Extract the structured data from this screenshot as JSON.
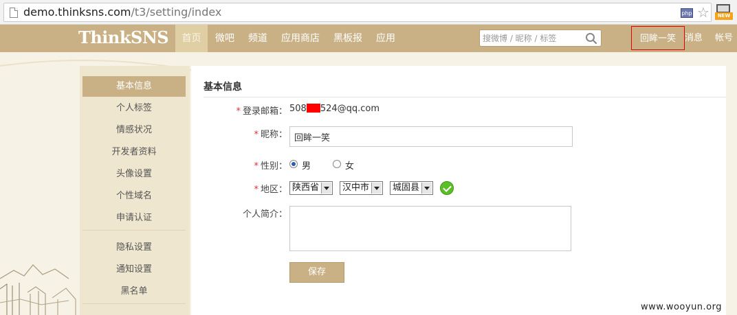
{
  "browser": {
    "url_host": "demo.thinksns.com",
    "url_path": "/t3/setting/index",
    "php_badge": "php",
    "new_badge": "NEW"
  },
  "nav": {
    "logo": "ThinkSNS",
    "items": [
      {
        "label": "首页",
        "active": true
      },
      {
        "label": "微吧",
        "active": false
      },
      {
        "label": "频道",
        "active": false
      },
      {
        "label": "应用商店",
        "active": false
      },
      {
        "label": "黑板报",
        "active": false
      },
      {
        "label": "应用",
        "active": false
      }
    ],
    "search_placeholder": "搜微博 / 昵称 / 标签",
    "user": "回眸一笑",
    "messages": "消息",
    "account": "帐号"
  },
  "sidebar": {
    "items": [
      {
        "label": "基本信息",
        "active": true
      },
      {
        "label": "个人标签",
        "active": false
      },
      {
        "label": "情感状况",
        "active": false
      },
      {
        "label": "开发者资料",
        "active": false
      },
      {
        "label": "头像设置",
        "active": false
      },
      {
        "label": "个性域名",
        "active": false
      },
      {
        "label": "申请认证",
        "active": false
      },
      {
        "label": "隐私设置",
        "active": false
      },
      {
        "label": "通知设置",
        "active": false
      },
      {
        "label": "黑名单",
        "active": false
      }
    ]
  },
  "form": {
    "title": "基本信息",
    "required_mark": "*",
    "email_label": "登录邮箱：",
    "email_prefix": "508",
    "email_suffix": "524@qq.com",
    "nickname_label": "昵称：",
    "nickname_value": "回眸一笑",
    "gender_label": "性别：",
    "gender_male": "男",
    "gender_female": "女",
    "gender_selected": "男",
    "region_label": "地区：",
    "province": "陕西省",
    "city": "汉中市",
    "county": "城固县",
    "bio_label": "个人简介：",
    "bio_value": "",
    "save_label": "保存"
  },
  "watermark": "www.wooyun.org",
  "colors": {
    "nav_bg": "#c9b185",
    "nav_active": "#e0cfa5",
    "highlight_border": "#e00000",
    "redaction": "#ff0000",
    "success": "#5cbf2a"
  }
}
